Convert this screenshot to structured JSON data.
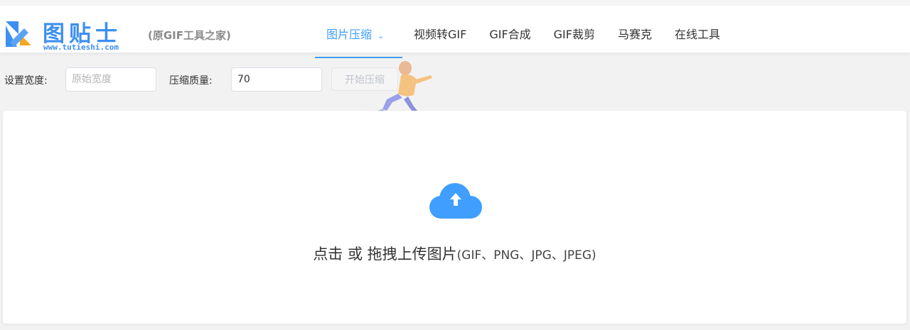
{
  "header": {
    "logo_text": "图贴士",
    "logo_url": "www.tutieshi.com",
    "slogan": "(原GIF工具之家)"
  },
  "nav": {
    "items": [
      {
        "label": "图片压缩",
        "active": true
      },
      {
        "label": "视频转GIF"
      },
      {
        "label": "GIF合成"
      },
      {
        "label": "GIF裁剪"
      },
      {
        "label": "马赛克"
      },
      {
        "label": "在线工具"
      }
    ],
    "dropdown_icon": "chevron-down-icon"
  },
  "controls": {
    "width_label": "设置宽度:",
    "width_placeholder": "原始宽度",
    "quality_label": "压缩质量:",
    "quality_value": "70",
    "start_button": "开始压缩"
  },
  "upload": {
    "icon": "cloud-upload-icon",
    "text": "点击 或 拖拽上传图片",
    "formats": "(GIF、PNG、JPG、JPEG)"
  },
  "colors": {
    "accent": "#409eff",
    "logo_blue": "#3d8ff0",
    "logo_orange": "#f5a623"
  }
}
